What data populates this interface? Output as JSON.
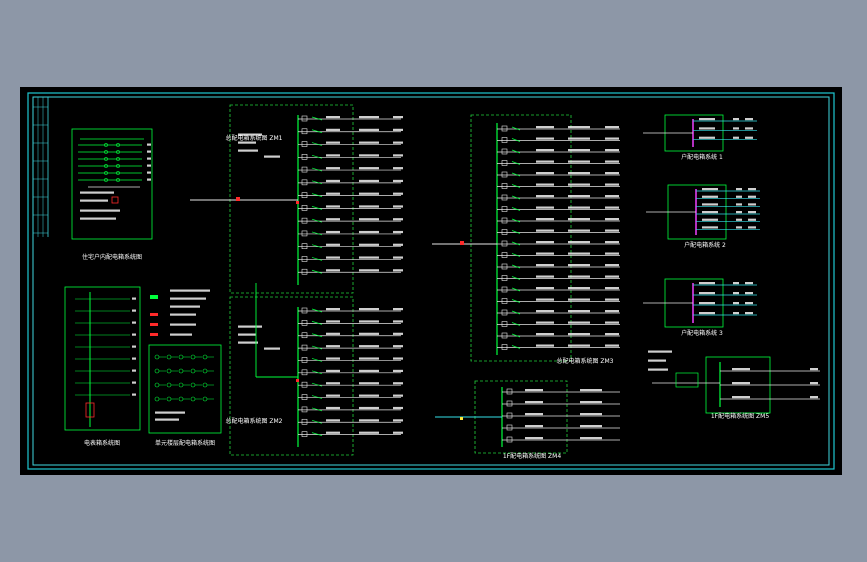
{
  "colors": {
    "background": "#8d97a7",
    "canvas": "#000000",
    "frame": "#1ec8d2",
    "frame_inner": "#3fd7e0",
    "wire_green": "#00ff3c",
    "wire_white": "#e6e6e6",
    "magenta": "#e23cf0",
    "cyan": "#33e0e8",
    "red": "#ff2a2a",
    "yellow": "#ffe83a",
    "dash": "#22d13c"
  },
  "panels": {
    "left_top": {
      "caption": "住宅户内配电箱系统图"
    },
    "left_mid_a": {
      "caption": "电表箱系统图"
    },
    "left_mid_b": {
      "caption": "单元楼层配电箱系统图"
    },
    "center_top": {
      "caption": "总配电箱系统图 ZM1"
    },
    "center_bottom": {
      "caption": "总配电箱系统图 ZM2"
    },
    "mid_right_top": {
      "caption": "总配电箱系统图 ZM3"
    },
    "mid_right_bottom": {
      "caption": "1F配电箱系统图 ZM4"
    },
    "right_top_1": {
      "caption": "户配电箱系统 1"
    },
    "right_top_2": {
      "caption": "户配电箱系统 2"
    },
    "right_top_3": {
      "caption": "户配电箱系统 3"
    },
    "right_bottom": {
      "caption": "1F配电箱系统图 ZM5"
    }
  }
}
